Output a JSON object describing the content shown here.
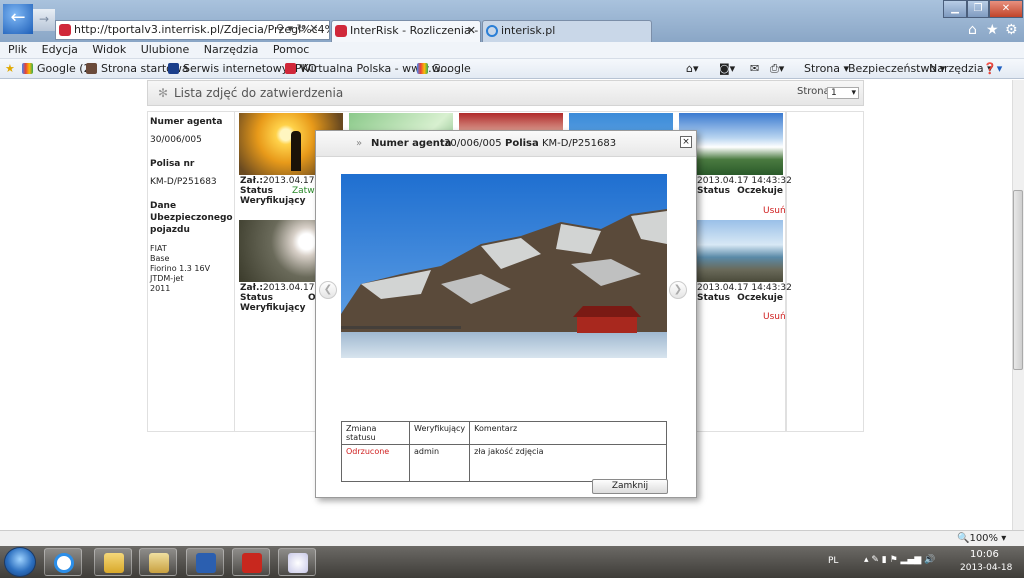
{
  "browser": {
    "url": "http://tportalv3.interrisk.pl/Zdjecia/Przegl%c4%85c",
    "tabs": [
      {
        "label": "InterRisk - Rozliczenia - Zdj..."
      },
      {
        "label": "interisk.pl"
      }
    ],
    "menu": [
      "Plik",
      "Edycja",
      "Widok",
      "Ulubione",
      "Narzędzia",
      "Pomoc"
    ],
    "favorites": [
      "Google (2)",
      "Strona startowa",
      "Serwis internetowy iPKO",
      "Wirtualna Polska - www.w...",
      "Google"
    ],
    "toolbar_right": [
      "Strona",
      "Bezpieczeństwo",
      "Narzędzia"
    ],
    "zoom": "100%"
  },
  "page": {
    "header_title": "Lista zdjęć do zatwierdzenia",
    "pager_label": "Strona",
    "pager_value": "1"
  },
  "sidebar": {
    "agent_label": "Numer agenta",
    "agent_value": "30/006/005",
    "policy_label": "Polisa nr",
    "policy_value": "KM-D/P251683",
    "vehicle_label": "Dane Ubezpieczonego pojazdu",
    "vehicle_lines": [
      "FIAT",
      "Base",
      "Fiorino 1.3 16V JTDM-jet",
      "2011"
    ]
  },
  "grid": {
    "row1": {
      "col1": {
        "zal": "Zał.:",
        "date": "2013.04.17 14",
        "status_label": "Status",
        "status": "Zatwi",
        "verifier_label": "Weryfikujący"
      },
      "col5": {
        "date": "2013.04.17 14:43:32",
        "status_label": "Status",
        "status": "Oczekuje",
        "delete": "Usuń"
      }
    },
    "row2": {
      "col1": {
        "zal": "Zał.:",
        "date": "2013.04.17 14",
        "status_label": "Status",
        "status": "O",
        "verifier_label": "Weryfikujący"
      },
      "col5": {
        "date": "2013.04.17 14:43:32",
        "status_label": "Status",
        "status": "Oczekuje",
        "delete": "Usuń"
      }
    }
  },
  "dialog": {
    "agent_label": "Numer agenta",
    "agent_value": "30/006/005",
    "policy_label": "Polisa",
    "policy_value": "KM-D/P251683",
    "close_x": "×",
    "table_headers": [
      "Zmiana statusu",
      "Weryfikujący",
      "Komentarz"
    ],
    "rows": [
      {
        "status": "Odrzucone",
        "verifier": "admin",
        "comment": "zła jakość zdjęcia"
      }
    ],
    "close_button": "Zamknij"
  },
  "taskbar": {
    "lang": "PL",
    "time": "10:06",
    "date": "2013-04-18"
  },
  "colors": {
    "rejected": "#d02020",
    "accepted": "#2a8a2a",
    "delete": "#d02020"
  }
}
